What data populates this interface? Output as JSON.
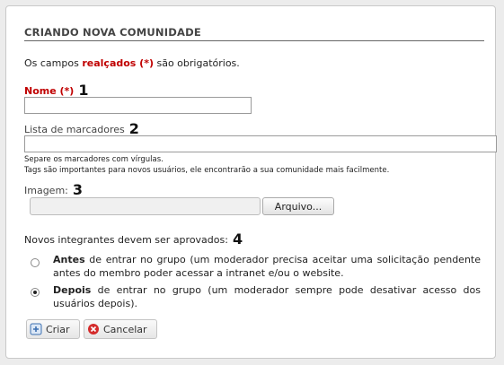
{
  "form": {
    "title": "Criando nova comunidade",
    "required_note": {
      "before": "Os campos ",
      "highlight": "realçados (*)",
      "after": " são obrigatórios."
    },
    "name": {
      "label": "Nome (*)",
      "marker": "1",
      "value": ""
    },
    "tags": {
      "label": "Lista de marcadores",
      "marker": "2",
      "value": "",
      "hint_line1": "Separe os marcadores com vírgulas.",
      "hint_line2": "Tags são importantes para novos usuários, ele encontrarão a sua comunidade mais facilmente."
    },
    "image": {
      "label": "Imagem:",
      "marker": "3",
      "browse_label": "Arquivo..."
    },
    "approval": {
      "label": "Novos integrantes devem ser aprovados:",
      "marker": "4",
      "options": [
        {
          "bold": "Antes",
          "text": " de entrar no grupo (um moderador precisa aceitar uma solicitação pendente antes do membro poder acessar a intranet e/ou o website.",
          "selected": false
        },
        {
          "bold": "Depois",
          "text": " de entrar no grupo (um moderador sempre pode desativar acesso dos usuários depois).",
          "selected": true
        }
      ]
    },
    "actions": {
      "create_label": "Criar",
      "cancel_label": "Cancelar"
    }
  },
  "colors": {
    "required": "#c00000",
    "cancel_icon": "#d42b2b",
    "create_icon": "#3b6fb0"
  }
}
